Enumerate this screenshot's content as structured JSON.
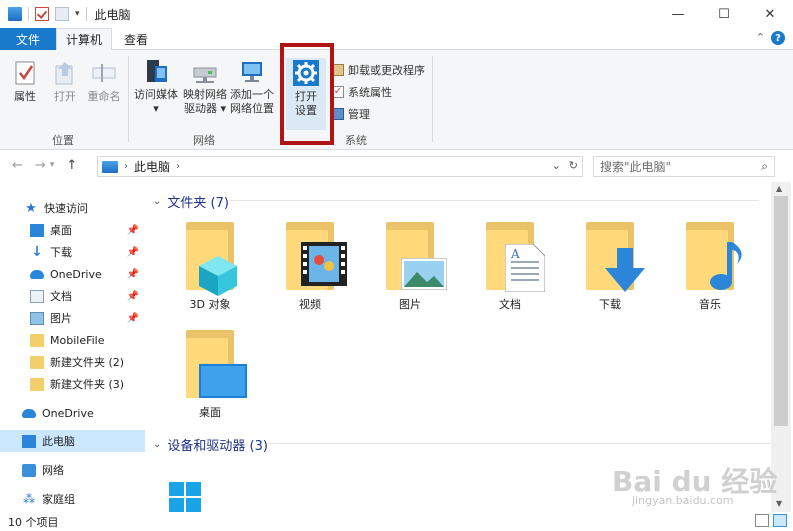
{
  "window": {
    "title": "此电脑",
    "controls": [
      "—",
      "☐",
      "✕"
    ]
  },
  "tabs": {
    "file": "文件",
    "computer": "计算机",
    "view": "查看"
  },
  "ribbon": {
    "location": {
      "label": "位置",
      "buttons": [
        "属性",
        "打开",
        "重命名"
      ]
    },
    "network": {
      "label": "网络",
      "access_media": [
        "访问媒体",
        "▾"
      ],
      "map_drive": [
        "映射网络",
        "驱动器 ▾"
      ],
      "add_location": [
        "添加一个",
        "网络位置"
      ]
    },
    "system": {
      "label": "系统",
      "open_settings": [
        "打开",
        "设置"
      ],
      "uninstall": "卸载或更改程序",
      "system_props": "系统属性",
      "manage": "管理"
    },
    "highlight_color": "#b01515"
  },
  "address": {
    "path": "此电脑",
    "search_placeholder": "搜索\"此电脑\""
  },
  "navpane": {
    "quick_access": "快速访问",
    "items": [
      {
        "label": "桌面",
        "icon": "desktop-icon",
        "pinned": true
      },
      {
        "label": "下载",
        "icon": "download-icon",
        "pinned": true
      },
      {
        "label": "OneDrive",
        "icon": "onedrive-icon",
        "pinned": true
      },
      {
        "label": "文档",
        "icon": "documents-icon",
        "pinned": true
      },
      {
        "label": "图片",
        "icon": "pictures-icon",
        "pinned": true
      },
      {
        "label": "MobileFile",
        "icon": "folder-icon",
        "pinned": false
      },
      {
        "label": "新建文件夹 (2)",
        "icon": "folder-icon",
        "pinned": false
      },
      {
        "label": "新建文件夹 (3)",
        "icon": "folder-icon",
        "pinned": false
      }
    ],
    "onedrive": "OneDrive",
    "this_pc": "此电脑",
    "network": "网络",
    "homegroup": "家庭组"
  },
  "content": {
    "folders_header": "文件夹 (7)",
    "folders": [
      "3D 对象",
      "视频",
      "图片",
      "文档",
      "下载",
      "音乐",
      "桌面"
    ],
    "devices_header": "设备和驱动器 (3)"
  },
  "status": {
    "count": "10 个项目"
  },
  "watermark": {
    "main": "Bai du 经验",
    "sub": "jingyan.baidu.com"
  }
}
